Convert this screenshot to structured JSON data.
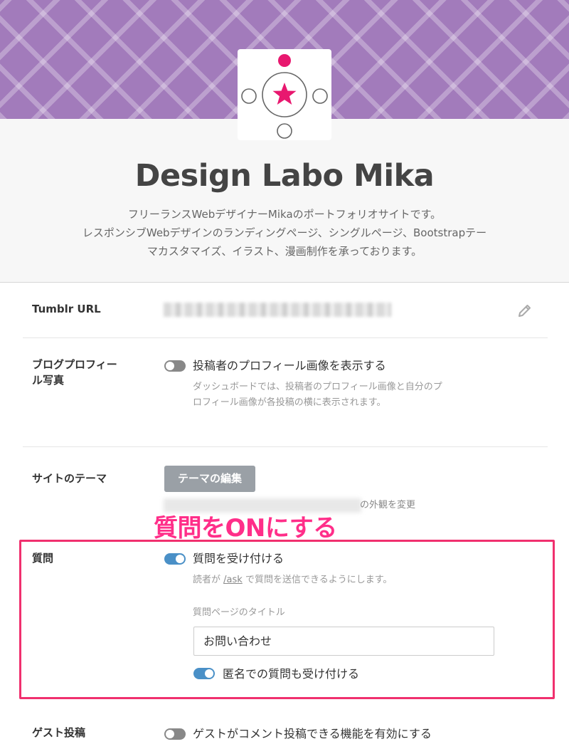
{
  "blog": {
    "title": "Design Labo Mika",
    "description_lines": [
      "フリーランスWebデザイナーMikaのポートフォリオサイトです。",
      "レスポンシブWebデザインのランディングページ、シングルページ、Bootstrapテー",
      "マカスタマイズ、イラスト、漫画制作を承っております。"
    ],
    "banner_color": "#a27bbb",
    "logo_accent_color": "#e8186f"
  },
  "settings": {
    "tumblr_url": {
      "label": "Tumblr URL",
      "edit_icon": "pencil-icon"
    },
    "profile_photo": {
      "label_lines": [
        "ブログプロフィー",
        "ル写真"
      ],
      "toggle_label": "投稿者のプロフィール画像を表示する",
      "toggle_on": false,
      "help_lines": [
        "ダッシュボードでは、投稿者のプロフィール画像と自分のプ",
        "ロフィール画像が各投稿の横に表示されます。"
      ]
    },
    "theme": {
      "label": "サイトのテーマ",
      "button_label": "テーマの編集",
      "help_visible": "の外観を変更"
    },
    "ask": {
      "label": "質問",
      "toggle_label": "質問を受け付ける",
      "toggle_on": true,
      "help_prefix": "読者が",
      "help_link": "/ask",
      "help_suffix": "で質問を送信できるようにします。",
      "page_title_label": "質問ページのタイトル",
      "page_title_value": "お問い合わせ",
      "anon_label": "匿名での質問も受け付ける",
      "anon_on": true
    },
    "guest": {
      "label": "ゲスト投稿",
      "toggle_label": "ゲストがコメント投稿できる機能を有効にする",
      "toggle_on": false
    }
  },
  "annotation": {
    "text": "質問をONにする",
    "color": "#ff2e89"
  }
}
